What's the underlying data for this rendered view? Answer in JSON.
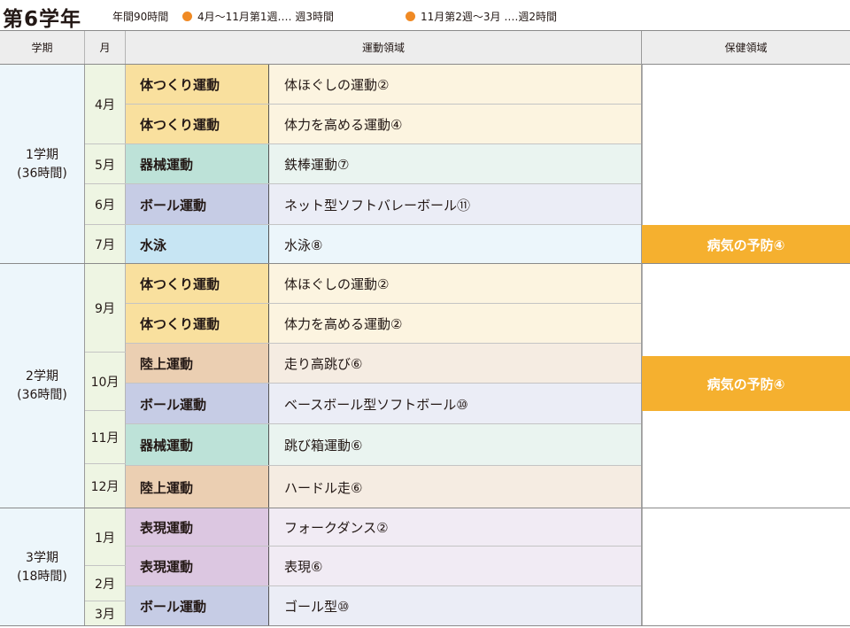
{
  "title": "第6学年",
  "hours": "年間90時間",
  "legend": [
    {
      "text": "4月～11月第1週‥‥ 週3時間",
      "color": "#f08a24"
    },
    {
      "text": "11月第2週～3月 ‥‥週2時間",
      "color": "#f08a24"
    }
  ],
  "headers": {
    "term": "学期",
    "month": "月",
    "sports": "運動領域",
    "health": "保健領域"
  },
  "terms": [
    {
      "name": "1学期",
      "hours": "(36時間)"
    },
    {
      "name": "2学期",
      "hours": "(36時間)"
    },
    {
      "name": "3学期",
      "hours": "(18時間)"
    }
  ],
  "months": [
    "4月",
    "5月",
    "6月",
    "7月",
    "9月",
    "10月",
    "11月",
    "12月",
    "1月",
    "2月",
    "3月"
  ],
  "rows": [
    {
      "category": "体つくり運動",
      "activity": "体ほぐしの運動②"
    },
    {
      "category": "体つくり運動",
      "activity": "体力を高める運動④"
    },
    {
      "category": "器械運動",
      "activity": "鉄棒運動⑦"
    },
    {
      "category": "ボール運動",
      "activity": "ネット型ソフトバレーボール⑪"
    },
    {
      "category": "水泳",
      "activity": "水泳⑧"
    },
    {
      "category": "体つくり運動",
      "activity": "体ほぐしの運動②"
    },
    {
      "category": "体つくり運動",
      "activity": "体力を高める運動②"
    },
    {
      "category": "陸上運動",
      "activity": "走り高跳び⑥"
    },
    {
      "category": "ボール運動",
      "activity": "ベースボール型ソフトボール⑩"
    },
    {
      "category": "器械運動",
      "activity": "跳び箱運動⑥"
    },
    {
      "category": "陸上運動",
      "activity": "ハードル走⑥"
    },
    {
      "category": "表現運動",
      "activity": "フォークダンス②"
    },
    {
      "category": "表現運動",
      "activity": "表現⑥"
    },
    {
      "category": "ボール運動",
      "activity": "ゴール型⑩"
    }
  ],
  "health": [
    "病気の予防④",
    "病気の予防④"
  ],
  "colors": {
    "health": "#f5b02f",
    "term_bg": "#edf6fb",
    "month_bg": "#eef5e3",
    "header_bg": "#ededed"
  }
}
